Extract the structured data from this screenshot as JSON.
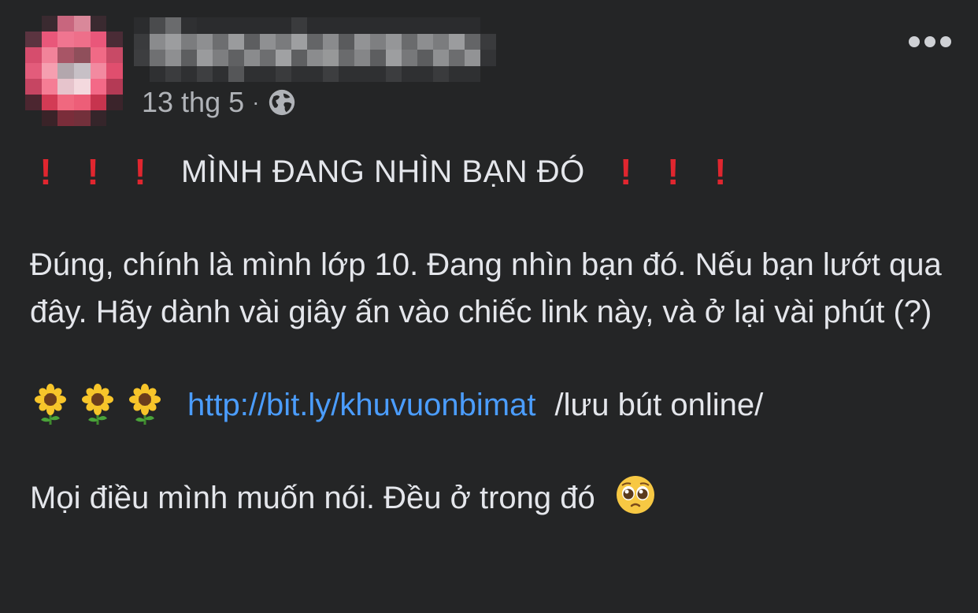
{
  "post": {
    "timestamp": "13 thg 5",
    "separator": "·",
    "headline": "MÌNH ĐANG NHÌN BẠN ĐÓ",
    "body": "Đúng, chính là mình lớp 10. Đang nhìn bạn đó. Nếu bạn lướt qua đây. Hãy dành vài giây ấn vào chiếc link này, và ở lại vài phút (?)",
    "link": {
      "url_text": "http://bit.ly/khuvuonbimat",
      "suffix": "/lưu bút online/"
    },
    "closing": "Mọi điều mình muốn nói. Đều ở trong đó"
  },
  "icons": {
    "privacy": "globe-icon",
    "menu": "more-options-icon",
    "emphasis": "red-exclamation-icon",
    "decoration": "sunflower-icon",
    "emotion": "pleading-face-icon"
  },
  "colors": {
    "background": "#242526",
    "text": "#e4e6eb",
    "muted": "#b0b3b8",
    "link": "#4b9dff",
    "exclamation": "#e0262f"
  }
}
